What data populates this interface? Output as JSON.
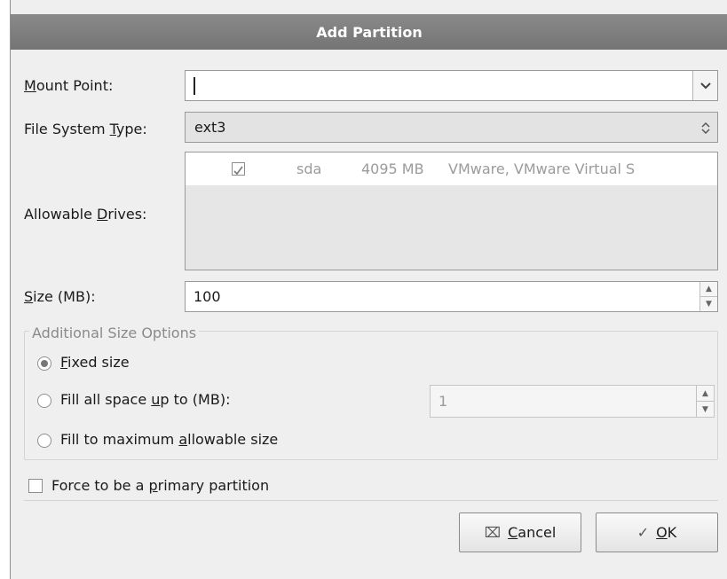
{
  "dialog": {
    "title": "Add Partition"
  },
  "mount_point": {
    "label_pre": "",
    "label_key": "M",
    "label_post": "ount Point:",
    "value": ""
  },
  "fs_type": {
    "label_pre": "File System ",
    "label_key": "T",
    "label_post": "ype:",
    "value": "ext3"
  },
  "drives": {
    "label_pre": "Allowable ",
    "label_key": "D",
    "label_post": "rives:",
    "rows": [
      {
        "checked": true,
        "device": "sda",
        "size": "4095 MB",
        "model": "VMware, VMware Virtual S"
      }
    ]
  },
  "size": {
    "label_pre": "",
    "label_key": "S",
    "label_post": "ize (MB):",
    "value": "100"
  },
  "size_options": {
    "title": "Additional Size Options",
    "fixed": {
      "pre": "",
      "key": "F",
      "post": "ixed size",
      "selected": true
    },
    "fill_upto": {
      "pre": "Fill all space ",
      "key": "u",
      "post": "p to (MB):",
      "selected": false,
      "value": "1"
    },
    "fill_max": {
      "pre": "Fill to maximum ",
      "key": "a",
      "post": "llowable size",
      "selected": false
    }
  },
  "primary": {
    "pre": "Force to be a ",
    "key": "p",
    "post": "rimary partition",
    "checked": false
  },
  "buttons": {
    "cancel": {
      "pre": "",
      "key": "C",
      "post": "ancel",
      "icon": "cancel-x-icon"
    },
    "ok": {
      "pre": "",
      "key": "O",
      "post": "K",
      "icon": "ok-check-icon"
    }
  },
  "colors": {
    "titlebar": "#7d7d7d",
    "dialog_bg": "#efefef",
    "disabled_text": "#9b9b9b"
  }
}
